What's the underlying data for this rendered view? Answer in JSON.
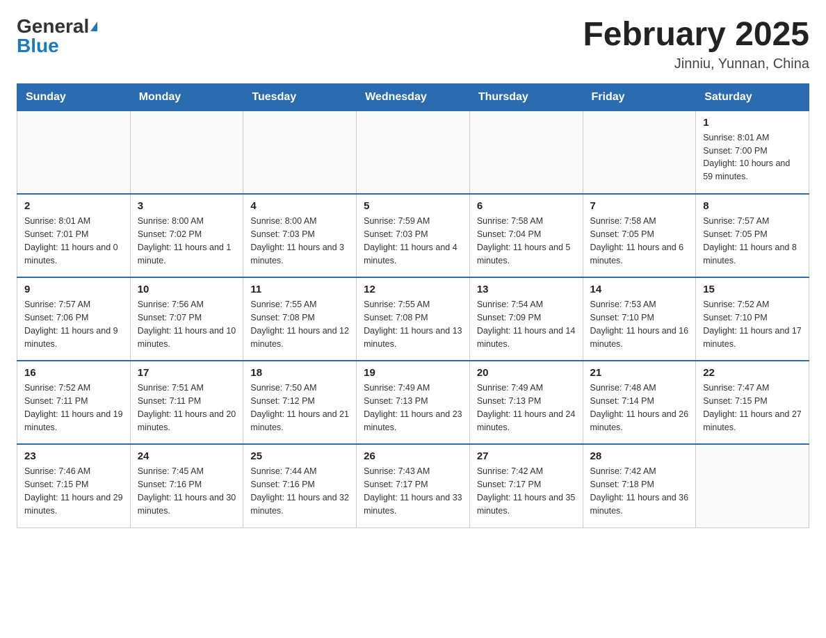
{
  "header": {
    "logo_general": "General",
    "logo_blue": "Blue",
    "month_title": "February 2025",
    "location": "Jinniu, Yunnan, China"
  },
  "days_of_week": [
    "Sunday",
    "Monday",
    "Tuesday",
    "Wednesday",
    "Thursday",
    "Friday",
    "Saturday"
  ],
  "weeks": [
    [
      {
        "day": "",
        "info": ""
      },
      {
        "day": "",
        "info": ""
      },
      {
        "day": "",
        "info": ""
      },
      {
        "day": "",
        "info": ""
      },
      {
        "day": "",
        "info": ""
      },
      {
        "day": "",
        "info": ""
      },
      {
        "day": "1",
        "info": "Sunrise: 8:01 AM\nSunset: 7:00 PM\nDaylight: 10 hours and 59 minutes."
      }
    ],
    [
      {
        "day": "2",
        "info": "Sunrise: 8:01 AM\nSunset: 7:01 PM\nDaylight: 11 hours and 0 minutes."
      },
      {
        "day": "3",
        "info": "Sunrise: 8:00 AM\nSunset: 7:02 PM\nDaylight: 11 hours and 1 minute."
      },
      {
        "day": "4",
        "info": "Sunrise: 8:00 AM\nSunset: 7:03 PM\nDaylight: 11 hours and 3 minutes."
      },
      {
        "day": "5",
        "info": "Sunrise: 7:59 AM\nSunset: 7:03 PM\nDaylight: 11 hours and 4 minutes."
      },
      {
        "day": "6",
        "info": "Sunrise: 7:58 AM\nSunset: 7:04 PM\nDaylight: 11 hours and 5 minutes."
      },
      {
        "day": "7",
        "info": "Sunrise: 7:58 AM\nSunset: 7:05 PM\nDaylight: 11 hours and 6 minutes."
      },
      {
        "day": "8",
        "info": "Sunrise: 7:57 AM\nSunset: 7:05 PM\nDaylight: 11 hours and 8 minutes."
      }
    ],
    [
      {
        "day": "9",
        "info": "Sunrise: 7:57 AM\nSunset: 7:06 PM\nDaylight: 11 hours and 9 minutes."
      },
      {
        "day": "10",
        "info": "Sunrise: 7:56 AM\nSunset: 7:07 PM\nDaylight: 11 hours and 10 minutes."
      },
      {
        "day": "11",
        "info": "Sunrise: 7:55 AM\nSunset: 7:08 PM\nDaylight: 11 hours and 12 minutes."
      },
      {
        "day": "12",
        "info": "Sunrise: 7:55 AM\nSunset: 7:08 PM\nDaylight: 11 hours and 13 minutes."
      },
      {
        "day": "13",
        "info": "Sunrise: 7:54 AM\nSunset: 7:09 PM\nDaylight: 11 hours and 14 minutes."
      },
      {
        "day": "14",
        "info": "Sunrise: 7:53 AM\nSunset: 7:10 PM\nDaylight: 11 hours and 16 minutes."
      },
      {
        "day": "15",
        "info": "Sunrise: 7:52 AM\nSunset: 7:10 PM\nDaylight: 11 hours and 17 minutes."
      }
    ],
    [
      {
        "day": "16",
        "info": "Sunrise: 7:52 AM\nSunset: 7:11 PM\nDaylight: 11 hours and 19 minutes."
      },
      {
        "day": "17",
        "info": "Sunrise: 7:51 AM\nSunset: 7:11 PM\nDaylight: 11 hours and 20 minutes."
      },
      {
        "day": "18",
        "info": "Sunrise: 7:50 AM\nSunset: 7:12 PM\nDaylight: 11 hours and 21 minutes."
      },
      {
        "day": "19",
        "info": "Sunrise: 7:49 AM\nSunset: 7:13 PM\nDaylight: 11 hours and 23 minutes."
      },
      {
        "day": "20",
        "info": "Sunrise: 7:49 AM\nSunset: 7:13 PM\nDaylight: 11 hours and 24 minutes."
      },
      {
        "day": "21",
        "info": "Sunrise: 7:48 AM\nSunset: 7:14 PM\nDaylight: 11 hours and 26 minutes."
      },
      {
        "day": "22",
        "info": "Sunrise: 7:47 AM\nSunset: 7:15 PM\nDaylight: 11 hours and 27 minutes."
      }
    ],
    [
      {
        "day": "23",
        "info": "Sunrise: 7:46 AM\nSunset: 7:15 PM\nDaylight: 11 hours and 29 minutes."
      },
      {
        "day": "24",
        "info": "Sunrise: 7:45 AM\nSunset: 7:16 PM\nDaylight: 11 hours and 30 minutes."
      },
      {
        "day": "25",
        "info": "Sunrise: 7:44 AM\nSunset: 7:16 PM\nDaylight: 11 hours and 32 minutes."
      },
      {
        "day": "26",
        "info": "Sunrise: 7:43 AM\nSunset: 7:17 PM\nDaylight: 11 hours and 33 minutes."
      },
      {
        "day": "27",
        "info": "Sunrise: 7:42 AM\nSunset: 7:17 PM\nDaylight: 11 hours and 35 minutes."
      },
      {
        "day": "28",
        "info": "Sunrise: 7:42 AM\nSunset: 7:18 PM\nDaylight: 11 hours and 36 minutes."
      },
      {
        "day": "",
        "info": ""
      }
    ]
  ]
}
